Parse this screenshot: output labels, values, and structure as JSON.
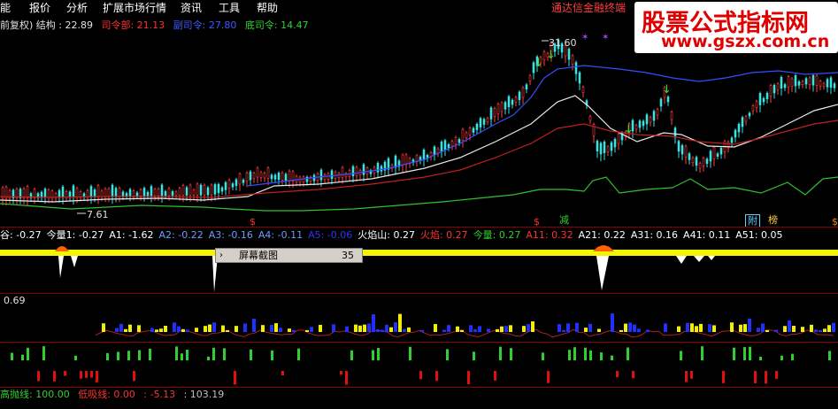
{
  "menu": {
    "items": [
      "能",
      "报价",
      "分析",
      "扩展市场行情",
      "资讯",
      "工具",
      "帮助"
    ],
    "right_title": "通达信金融终端"
  },
  "watermark": {
    "title": "股票公式指标网",
    "url": "www.gszx.com.cn"
  },
  "main_legend": {
    "prefix": "前复权) 结构 : 22.89",
    "items": [
      {
        "text": "司令部: 21.13",
        "color": "#ff3030"
      },
      {
        "text": "副司令: 27.80",
        "color": "#3b5bff"
      },
      {
        "text": "底司令: 14.47",
        "color": "#30d030"
      }
    ]
  },
  "price_labels": {
    "high": "31.60",
    "low": "7.61"
  },
  "sub_legend": {
    "items": [
      {
        "text": "谷: -0.27",
        "color": "#ffffff"
      },
      {
        "text": "今量1: -0.27",
        "color": "#ffffff"
      },
      {
        "text": "A1: -1.62",
        "color": "#ffffff"
      },
      {
        "text": "A2: -0.22",
        "color": "#6e9bff"
      },
      {
        "text": "A3: -0.16",
        "color": "#6e9bff"
      },
      {
        "text": "A4: -0.11",
        "color": "#6e9bff"
      },
      {
        "text": "A5: -0.06",
        "color": "#3030ff"
      },
      {
        "text": "火焰山: 0.27",
        "color": "#ffffff"
      },
      {
        "text": "火焰: 0.27",
        "color": "#ff3030"
      },
      {
        "text": "今量: 0.27",
        "color": "#30d030"
      },
      {
        "text": "A11: 0.32",
        "color": "#ff3030"
      },
      {
        "text": "A21: 0.22",
        "color": "#ffffff"
      },
      {
        "text": "A31: 0.16",
        "color": "#ffffff"
      },
      {
        "text": "A41: 0.11",
        "color": "#ffffff"
      },
      {
        "text": "A51: 0.05",
        "color": "#ffffff"
      }
    ]
  },
  "popup": {
    "text": "屏幕截图",
    "number": "35"
  },
  "panel3_value": "0.69",
  "bottom_legend": {
    "items": [
      {
        "text": "高抛线: 100.00",
        "color": "#30d030"
      },
      {
        "text": "低吸线: 0.00",
        "color": "#ff3030"
      },
      {
        "text": ": -5.13",
        "color": "#ff3030"
      },
      {
        "text": ": 103.19",
        "color": "#c0c0c0"
      }
    ]
  },
  "tags": {
    "reduce": "减",
    "fu": "附",
    "bang": "榜"
  }
}
